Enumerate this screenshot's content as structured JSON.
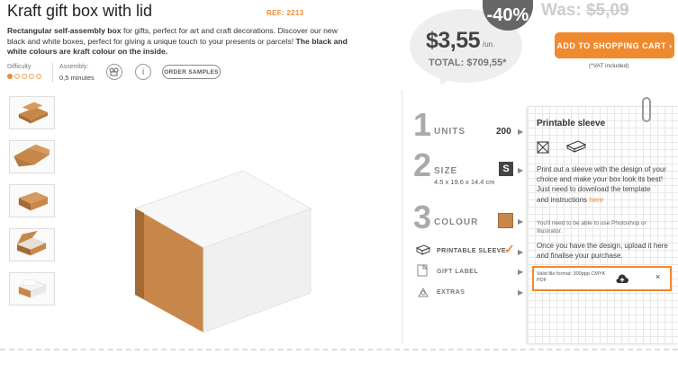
{
  "product": {
    "title": "Kraft gift box with lid",
    "ref": "REF: 2213",
    "desc_bold1": "Rectangular self-assembly box",
    "desc_text": " for gifts, perfect for art and craft decorations. Discover our new black and white boxes, perfect for giving a unique touch to your presents or parcels! ",
    "desc_bold2": "The black and white colours are kraft colour on the inside."
  },
  "meta": {
    "difficulty_label": "Difficulty",
    "difficulty_level": 1,
    "difficulty_max": 5,
    "assembly_label": "Assembly:",
    "assembly_value": "0,5 minutes",
    "order_samples": "ORDER SAMPLES"
  },
  "pricing": {
    "discount": "-40%",
    "was_label": "Was: ",
    "was_price": "$5,09",
    "price": "$3,55",
    "unit": "/un.",
    "total": "TOTAL: $709,55*",
    "add_to_cart": "ADD TO SHOPPING CART ›",
    "vat_note": "(*VAT included)"
  },
  "options": {
    "units": {
      "num": "1",
      "label": "UNITS",
      "value": "200"
    },
    "size": {
      "num": "2",
      "label": "SIZE",
      "value": "S",
      "dims": "4.5 x 19.6 x 14.4 cm"
    },
    "colour": {
      "num": "3",
      "label": "COLOUR",
      "swatch": "#c8874a"
    },
    "extras": [
      {
        "label": "PRINTABLE SLEEVE",
        "selected": true
      },
      {
        "label": "GIFT LABEL",
        "selected": false
      },
      {
        "label": "EXTRAS",
        "selected": false
      }
    ]
  },
  "panel": {
    "title": "Printable sleeve",
    "p1": "Print out a sleeve with the design of your choice and make your box look its best!",
    "p2": "Just need to download the template",
    "p3_text": "and instructions ",
    "p3_link": "here",
    "p4": "You'll need to be able to use Photoshop or Illustrator.",
    "p5": "Once you have the design, upload it here and finalise your purchase.",
    "upload_hint": "Valid file format: 300ppp CMYK PDF",
    "upload_close": "×"
  },
  "colors": {
    "accent": "#f08a2e",
    "kraft": "#c8874a"
  }
}
